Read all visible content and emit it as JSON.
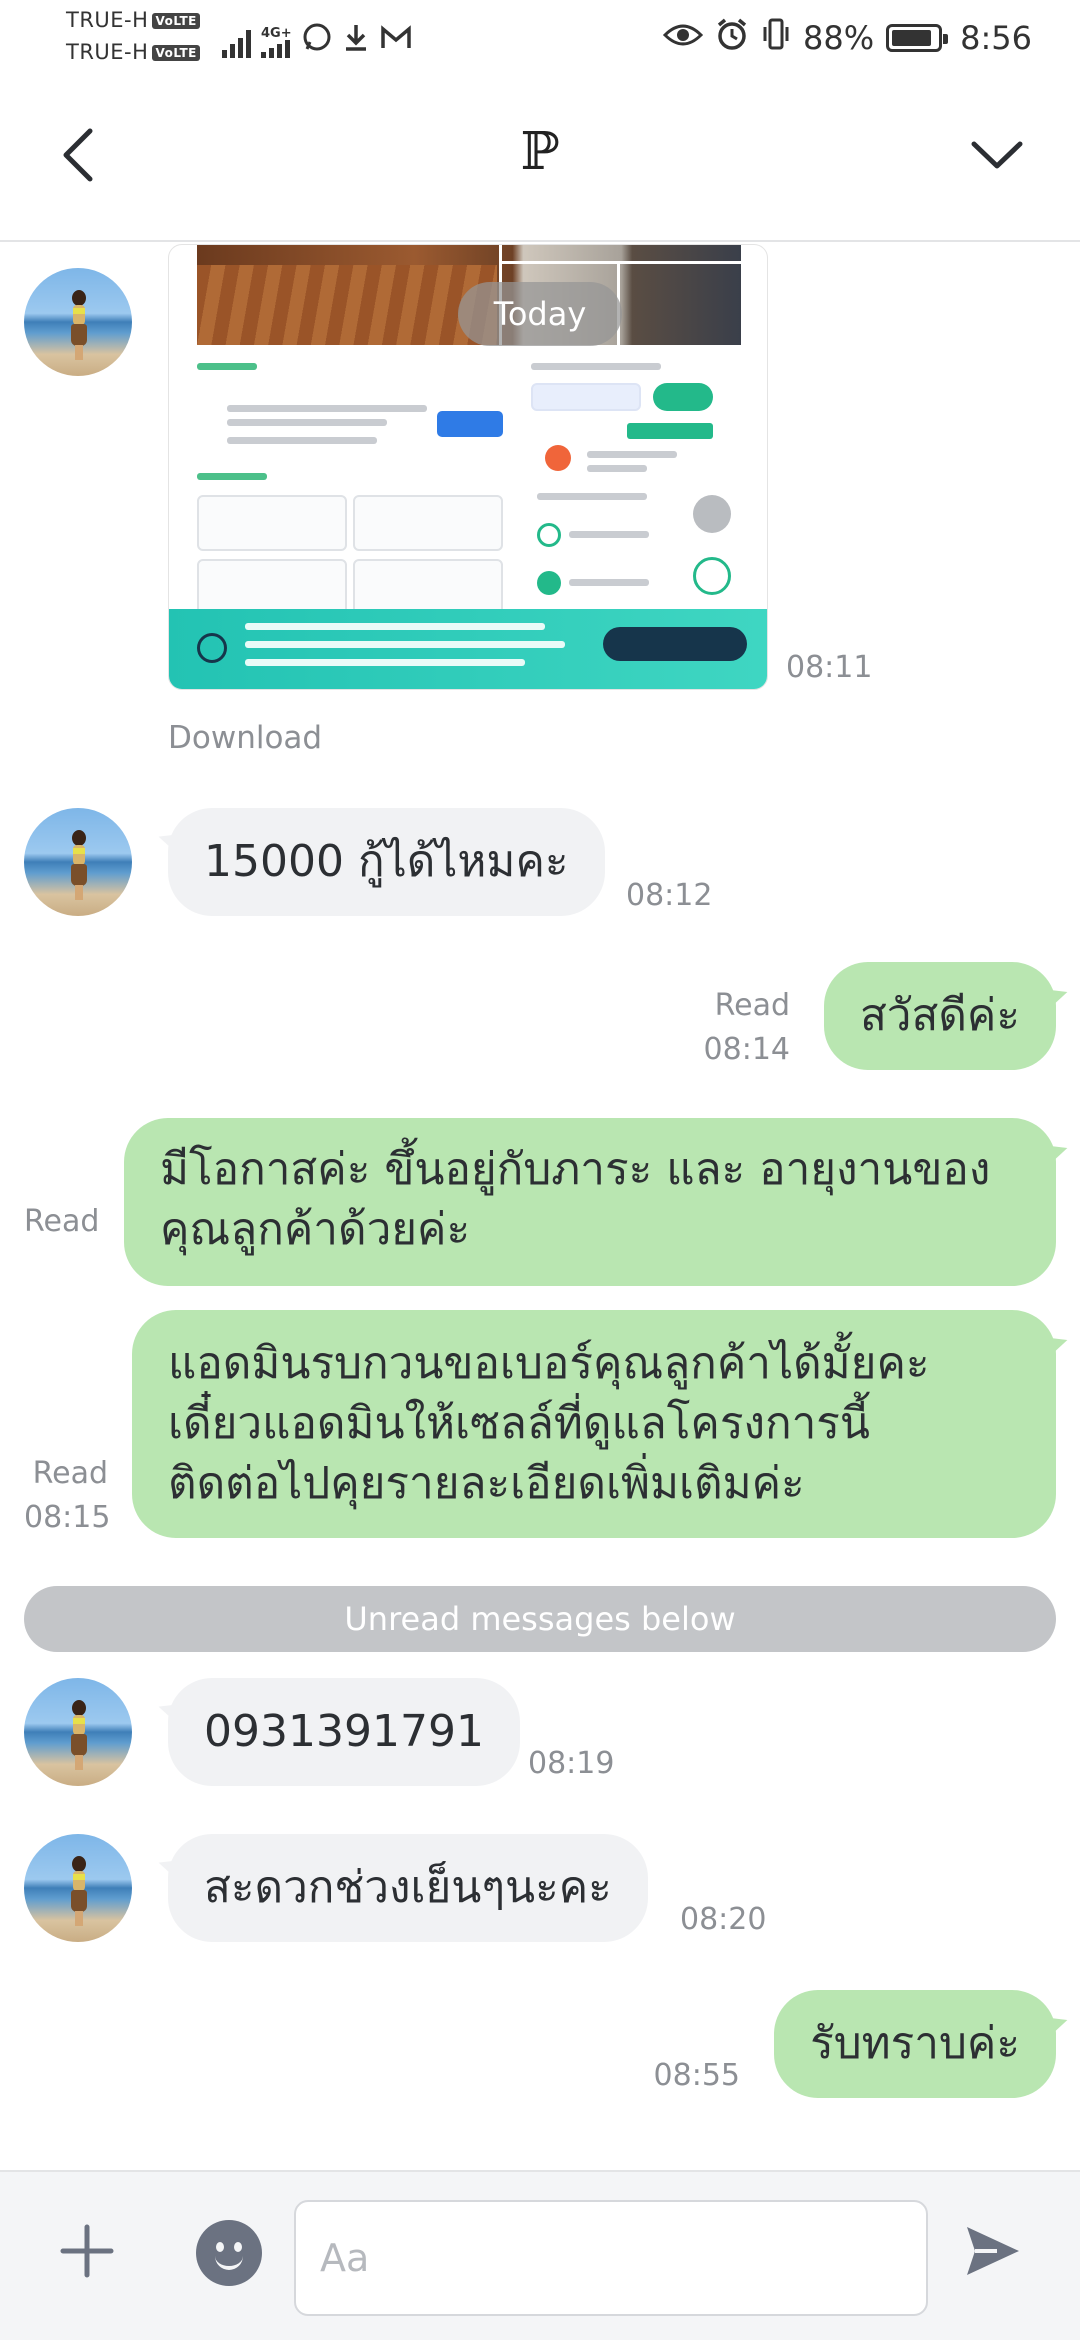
{
  "status_bar": {
    "carrier_1": "TRUE-H",
    "carrier_2": "TRUE-H",
    "volte_label": "VoLTE",
    "network_label": "4G+",
    "battery_percent": "88%",
    "battery_level": 0.88,
    "clock": "8:56",
    "icons": [
      "signal-icon",
      "whatsapp-icon",
      "download-icon",
      "gmail-icon",
      "eye-icon",
      "alarm-icon",
      "vibrate-icon",
      "battery-icon"
    ]
  },
  "header": {
    "title": "ℙ",
    "back_icon": "chevron-left-icon",
    "expand_icon": "chevron-down-icon"
  },
  "chat": {
    "date_divider": "Today",
    "image_message": {
      "time": "08:11",
      "download_label": "Download"
    },
    "messages": [
      {
        "direction": "in",
        "text": "15000 กู้ได้ไหมคะ",
        "time": "08:12"
      },
      {
        "direction": "out",
        "text": "สวัสดีค่ะ",
        "read": "Read",
        "time": "08:14"
      },
      {
        "direction": "out",
        "text_line1": "มีโอกาสค่ะ ขึ้นอยู่กับภาระ และ อายุงานของ",
        "text_line2": "คุณลูกค้าด้วยค่ะ",
        "read": "Read"
      },
      {
        "direction": "out",
        "text_line1": "แอดมินรบกวนขอเบอร์คุณลูกค้าได้มั้ยคะ",
        "text_line2": "เดี๋ยวแอดมินให้เซลล์ที่ดูแลโครงการนี้",
        "text_line3": "ติดต่อไปคุยรายละเอียดเพิ่มเติมค่ะ",
        "read": "Read",
        "time": "08:15"
      },
      {
        "direction": "in",
        "text": "0931391791",
        "time": "08:19"
      },
      {
        "direction": "in",
        "text": "สะดวกช่วงเย็นๆนะคะ",
        "time": "08:20"
      },
      {
        "direction": "out",
        "text": "รับทราบค่ะ",
        "time": "08:55"
      }
    ],
    "unread_divider": "Unread messages below"
  },
  "input_bar": {
    "placeholder": "Aa",
    "value": ""
  },
  "colors": {
    "outgoing_bubble": "#b9e6b1",
    "incoming_bubble": "#f1f2f4",
    "meta_text": "#8c8f94",
    "icon_gray": "#6b7281"
  }
}
